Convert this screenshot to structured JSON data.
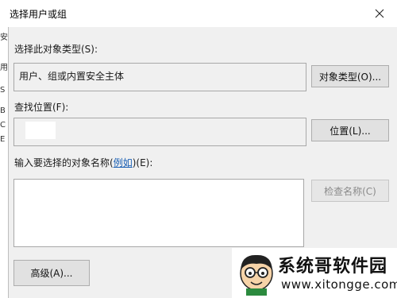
{
  "window": {
    "title": "选择用户或组"
  },
  "object_type": {
    "label": "选择此对象类型(S):",
    "value": "用户、组或内置安全主体",
    "button": "对象类型(O)..."
  },
  "location": {
    "label": "查找位置(F):",
    "value": "",
    "button": "位置(L)..."
  },
  "object_names": {
    "label_prefix": "输入要选择的对象名称(",
    "label_link": "例如",
    "label_suffix": ")(E):",
    "value": "",
    "check_button": "检查名称(C)"
  },
  "advanced_button": "高级(A)...",
  "left_edge": [
    "安",
    "用",
    "S",
    "B",
    "C",
    "E"
  ],
  "watermark": {
    "brand": "系统哥软件园",
    "url": "www.xitongge.com",
    "icon": "cartoon-mascot-icon"
  }
}
